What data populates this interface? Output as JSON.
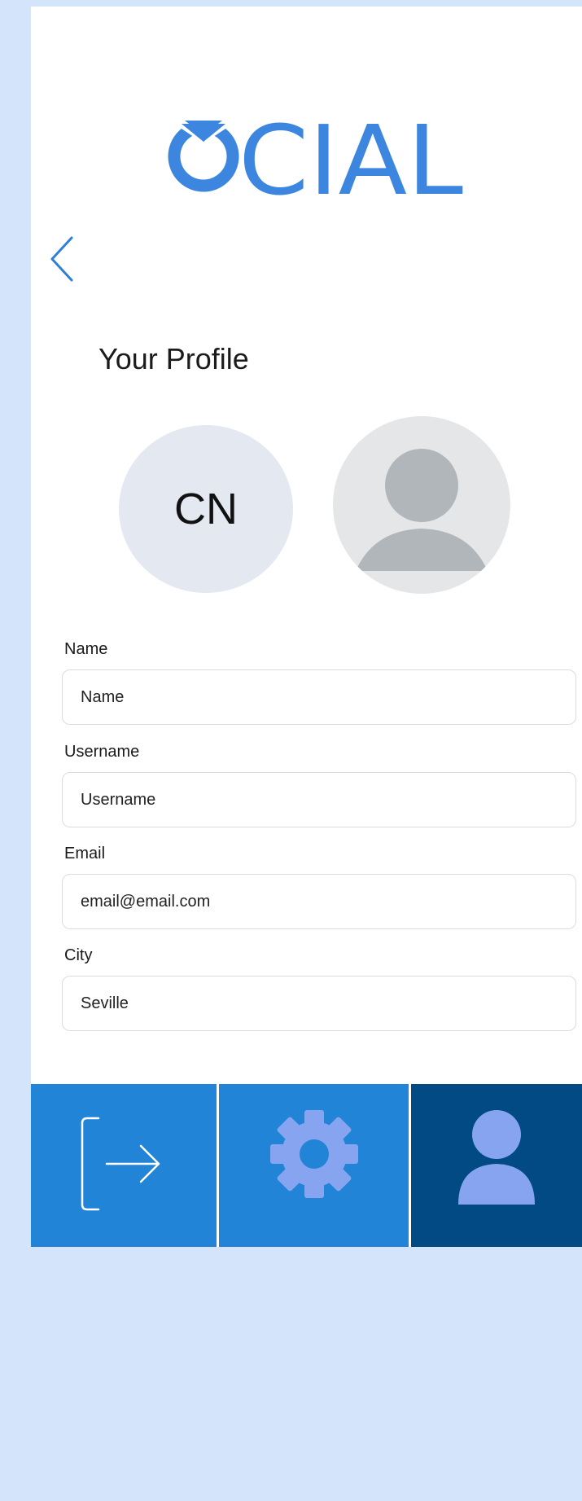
{
  "app": {
    "logo_text": "OCIAL",
    "brand_color": "#3c86e0"
  },
  "header": {
    "back_icon": "chevron-left-icon"
  },
  "profile": {
    "title": "Your Profile",
    "initials": "CN",
    "photo_icon": "user-placeholder-icon"
  },
  "form": {
    "name": {
      "label": "Name",
      "placeholder": "Name",
      "value": ""
    },
    "username": {
      "label": "Username",
      "placeholder": "Username",
      "value": ""
    },
    "email": {
      "label": "Email",
      "placeholder": "email@email.com",
      "value": ""
    },
    "city": {
      "label": "City",
      "placeholder": "Seville",
      "value": ""
    }
  },
  "tabbar": {
    "tabs": [
      {
        "icon": "logout-icon",
        "active": false
      },
      {
        "icon": "gear-icon",
        "active": false
      },
      {
        "icon": "user-icon",
        "active": true
      }
    ],
    "colors": {
      "inactive": "#2184d6",
      "active": "#014a83",
      "icon_fill": "#86a4ef"
    }
  }
}
